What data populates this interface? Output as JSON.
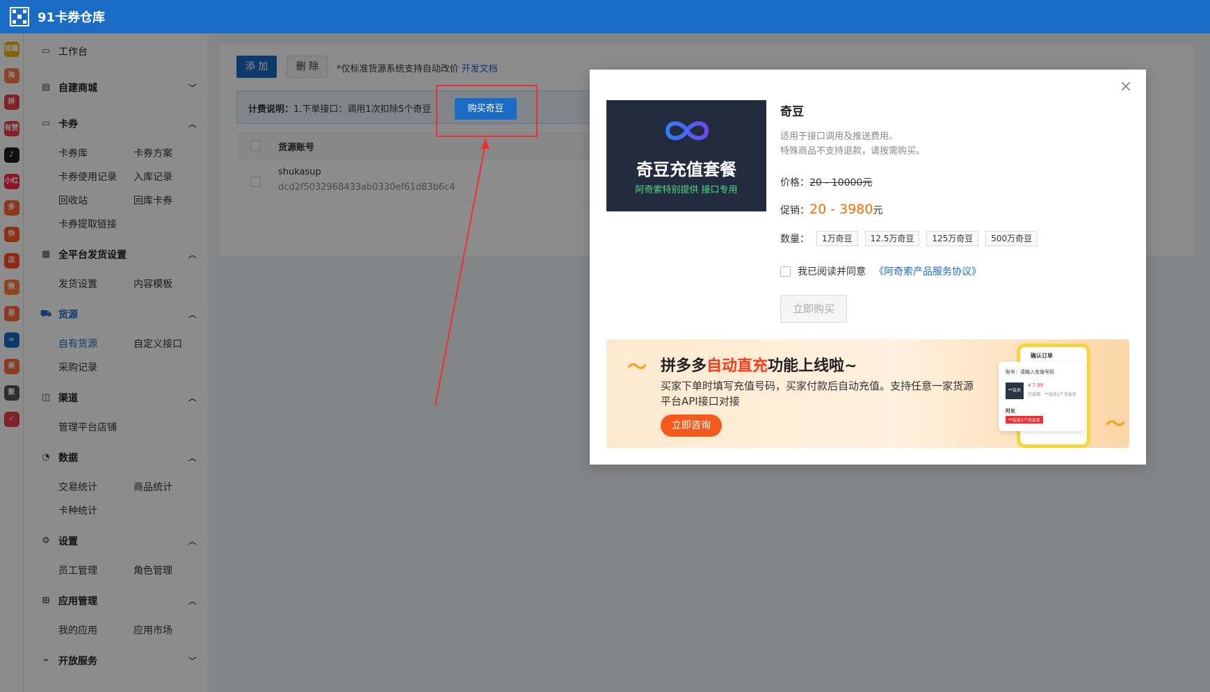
{
  "app": {
    "title": "91卡券仓库"
  },
  "rail": [
    {
      "label": "锦囊",
      "color": "#f5b400"
    },
    {
      "label": "淘",
      "color": "#ff7b4a"
    },
    {
      "label": "拼",
      "color": "#e8414c"
    },
    {
      "label": "有赞",
      "color": "#e8414c"
    },
    {
      "label": "♪",
      "color": "#222222"
    },
    {
      "label": "小红书",
      "color": "#ff2442"
    },
    {
      "label": "多",
      "color": "#ff6633"
    },
    {
      "label": "快",
      "color": "#ff5a1f"
    },
    {
      "label": "店",
      "color": "#ff4b2b"
    },
    {
      "label": "微",
      "color": "#ff7e3a"
    },
    {
      "label": "易",
      "color": "#ff6a3d"
    },
    {
      "label": "∞",
      "color": "#1a6bc4"
    },
    {
      "label": "美",
      "color": "#ff6a3d"
    },
    {
      "label": "聚",
      "color": "#555555"
    },
    {
      "label": "✓",
      "color": "#e8414c"
    }
  ],
  "sidebar": {
    "workbench": "工作台",
    "groups": [
      {
        "title": "自建商城",
        "icon": "store-icon",
        "chev": "⌄",
        "items": []
      },
      {
        "title": "卡券",
        "icon": "card-icon",
        "chev": "⌃",
        "items": [
          "卡券库",
          "卡券方案",
          "卡券使用记录",
          "入库记录",
          "回收站",
          "回库卡券",
          "卡券提取链接"
        ]
      },
      {
        "title": "全平台发货设置",
        "icon": "grid-icon",
        "chev": "⌃",
        "items": [
          "发货设置",
          "内容模板"
        ]
      },
      {
        "title": "货源",
        "icon": "cart-icon",
        "chev": "⌃",
        "items": [
          "自有货源",
          "自定义接口",
          "采购记录"
        ],
        "active": true
      },
      {
        "title": "渠道",
        "icon": "bag-icon",
        "chev": "⌃",
        "items": [
          "管理平台店铺"
        ]
      },
      {
        "title": "数据",
        "icon": "chart-icon",
        "chev": "⌃",
        "items": [
          "交易统计",
          "商品统计",
          "卡种统计"
        ]
      },
      {
        "title": "设置",
        "icon": "gear-icon",
        "chev": "⌃",
        "items": [
          "员工管理",
          "角色管理"
        ]
      },
      {
        "title": "应用管理",
        "icon": "apps-icon",
        "chev": "⌃",
        "items": [
          "我的应用",
          "应用市场"
        ]
      },
      {
        "title": "开放服务",
        "icon": "link-icon",
        "chev": "⌄",
        "items": []
      }
    ]
  },
  "toolbar": {
    "add_label": "添 加",
    "delete_label": "删 除",
    "note": "*仅标准货源系统支持自动改价",
    "doc_link": "开发文档"
  },
  "fee": {
    "label": "计费说明：",
    "text": "1.下单接口：调用1次扣除5个奇豆",
    "buy_button": "购买奇豆"
  },
  "table": {
    "header": "货源账号",
    "rows": [
      {
        "account": "shukasup",
        "key": "dcd2f5032968433ab0330ef61d83b6c4"
      }
    ]
  },
  "modal": {
    "image_title": "奇豆充值套餐",
    "image_subtitle": "阿奇索特别提供 接口专用",
    "name": "奇豆",
    "desc1": "适用于接口调用及推送费用。",
    "desc2": "特殊商品不支持退款，请按需购买。",
    "price_label": "价格：",
    "price_value": "20 - 10000元",
    "promo_label": "促销：",
    "promo_value": "20 - 3980",
    "promo_unit": "元",
    "qty_label": "数量：",
    "qty_options": [
      "1万奇豆",
      "12.5万奇豆",
      "125万奇豆",
      "500万奇豆"
    ],
    "agree_text": "我已阅读并同意",
    "agree_link": "《阿奇索产品服务协议》",
    "buy_now": "立即购买",
    "banner": {
      "title_pre": "拼多多",
      "title_hl": "自动直充",
      "title_post": "功能上线啦~",
      "body": "买家下单时填写充值号码，买家付款后自动充值。支持任意一家货源平台API接口对接",
      "button": "立即咨询",
      "card_title": "确认订单",
      "card_account": "账号：请输入充值号码",
      "card_thumb": "**会员",
      "card_price": "¥ 7.99",
      "card_sub": "已选择：**会员1个月会员",
      "card_duration": "时长",
      "card_tag": "**会员1个月会员"
    }
  },
  "colors": {
    "brand": "#1a6bc4",
    "promo": "#ff6a00",
    "annotation": "#f03030"
  }
}
